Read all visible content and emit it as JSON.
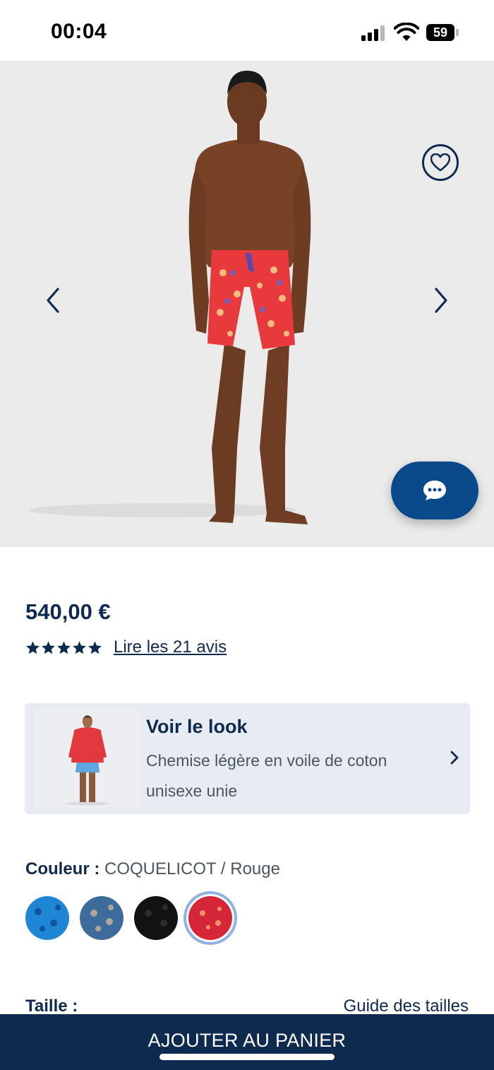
{
  "status_bar": {
    "time": "00:04",
    "battery": "59"
  },
  "product": {
    "price": "540,00 €",
    "rating_stars": 5,
    "reviews_link": "Lire les 21 avis"
  },
  "look": {
    "title": "Voir le look",
    "description": "Chemise légère en voile de coton unisexe unie"
  },
  "color": {
    "label": "Couleur :",
    "value": "COQUELICOT / Rouge",
    "swatches": [
      {
        "name": "Bleu",
        "hex": "#1f86d6"
      },
      {
        "name": "Bleu gris",
        "hex": "#3d6c9c"
      },
      {
        "name": "Noir",
        "hex": "#121212"
      },
      {
        "name": "Rouge",
        "hex": "#d6273a",
        "selected": true
      }
    ]
  },
  "size": {
    "label": "Taille :",
    "guide_link": "Guide des tailles"
  },
  "cta": {
    "label": "AJOUTER AU PANIER"
  },
  "colors": {
    "navy": "#0f2a4f",
    "chat_blue": "#0b4a8a",
    "hero_bg": "#ebebeb",
    "card_bg": "#e7ebf2"
  }
}
